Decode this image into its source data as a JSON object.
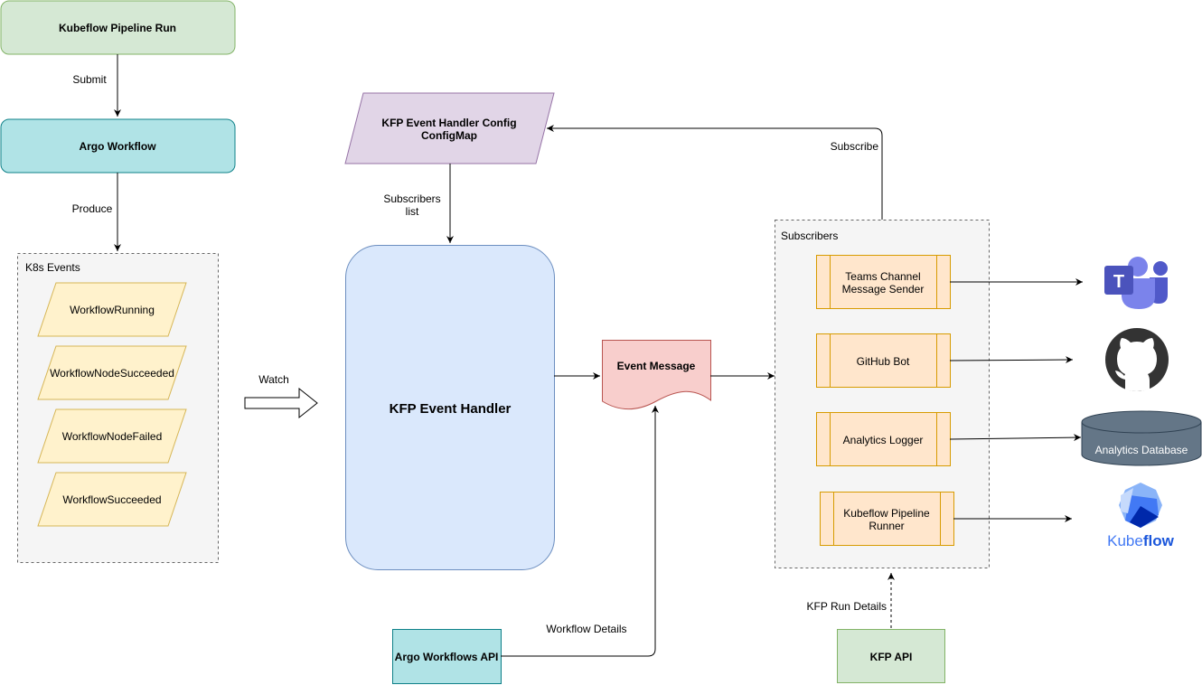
{
  "diagram": {
    "nodes": {
      "pipeline_run": "Kubeflow Pipeline Run",
      "argo_workflow": "Argo Workflow",
      "k8s_events_group": "K8s Events",
      "k8s_events": [
        "WorkflowRunning",
        "WorkflowNodeSucceeded",
        "WorkflowNodeFailed",
        "WorkflowSucceeded"
      ],
      "config_line1": "KFP Event Handler Config",
      "config_line2": "ConfigMap",
      "event_handler": "KFP Event Handler",
      "event_message": "Event Message",
      "subscribers_group": "Subscribers",
      "subscribers": [
        {
          "line1": "Teams Channel",
          "line2": "Message Sender"
        },
        {
          "line1": "GitHub Bot",
          "line2": ""
        },
        {
          "line1": "Analytics Logger",
          "line2": ""
        },
        {
          "line1": "Kubeflow Pipeline",
          "line2": "Runner"
        }
      ],
      "argo_api": "Argo Workflows API",
      "kfp_api": "KFP API",
      "analytics_db": "Analytics Database",
      "kubeflow_logo_text_a": "Kube",
      "kubeflow_logo_text_b": "flow",
      "teams_letter": "T"
    },
    "edges": {
      "submit": "Submit",
      "produce": "Produce",
      "watch": "Watch",
      "subscribers_list_1": "Subscribers",
      "subscribers_list_2": "list",
      "subscribe": "Subscribe",
      "workflow_details": "Workflow Details",
      "kfp_run_details": "KFP Run Details"
    },
    "icons": [
      "microsoft-teams-icon",
      "github-icon",
      "database-icon",
      "kubeflow-icon"
    ],
    "colors": {
      "green_fill": "#d5e8d4",
      "green_stroke": "#82b366",
      "teal_fill": "#b0e3e6",
      "teal_stroke": "#0e8088",
      "yellow_fill": "#fff2cc",
      "yellow_stroke": "#d6b656",
      "purple_fill": "#e1d5e7",
      "purple_stroke": "#9673a6",
      "blue_fill": "#dae8fc",
      "blue_stroke": "#6c8ebf",
      "red_fill": "#f8cecc",
      "red_stroke": "#b85450",
      "orange_fill": "#ffe6cc",
      "orange_stroke": "#d79b00",
      "group_fill": "#f5f5f5",
      "group_stroke": "#666666",
      "db_fill": "#647687",
      "db_stroke": "#314354"
    }
  }
}
